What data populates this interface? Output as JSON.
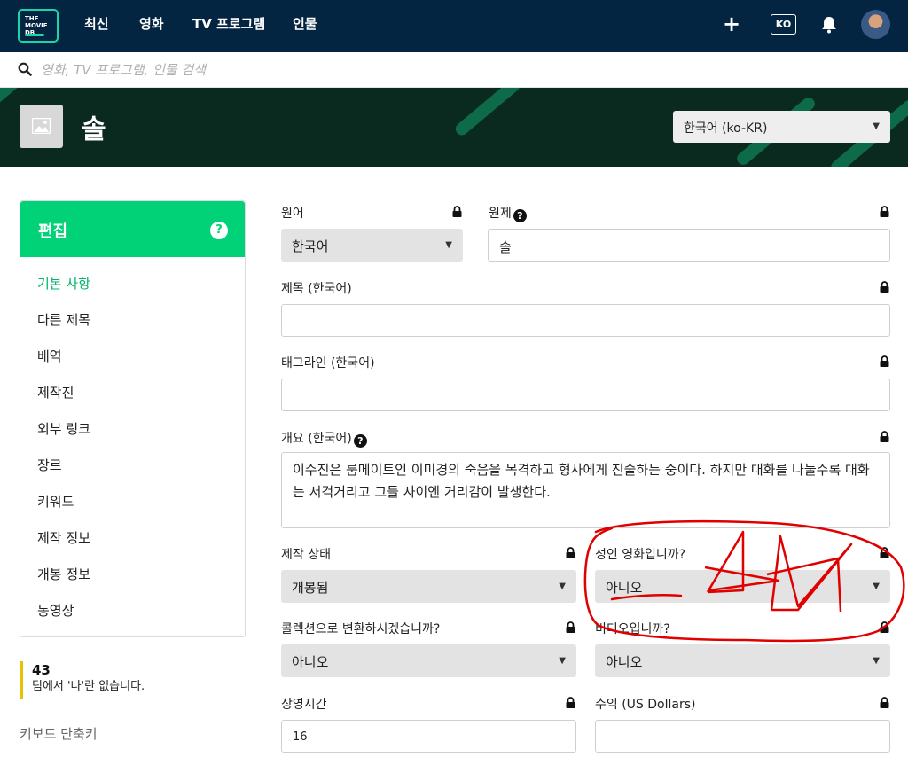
{
  "nav": {
    "logo_text": "THE\nMOVIE\nDB",
    "links": [
      "최신",
      "영화",
      "TV 프로그램",
      "인물"
    ],
    "add_label": "+",
    "language_code": "KO"
  },
  "search": {
    "placeholder": "영화, TV 프로그램, 인물 검색"
  },
  "hero": {
    "title": "솔",
    "language_select": "한국어 (ko-KR)"
  },
  "sidebar": {
    "title": "편집",
    "help": "?",
    "items": [
      "기본 사항",
      "다른 제목",
      "배역",
      "제작진",
      "외부 링크",
      "장르",
      "키워드",
      "제작 정보",
      "개봉 정보",
      "동영상"
    ],
    "active_index": 0
  },
  "team": {
    "count": "43",
    "text": "팀에서 '나'란 없습니다."
  },
  "keyboard_shortcuts": "키보드 단축키",
  "form": {
    "original_language": {
      "label": "원어",
      "value": "한국어"
    },
    "original_title": {
      "label": "원제",
      "value": "솔"
    },
    "title_ko": {
      "label": "제목 (한국어)",
      "value": ""
    },
    "tagline_ko": {
      "label": "태그라인 (한국어)",
      "value": ""
    },
    "overview_ko": {
      "label": "개요 (한국어)",
      "value": "이수진은 룸메이트인 이미경의 죽음을 목격하고 형사에게 진술하는 중이다. 하지만 대화를 나눌수록 대화는 서걱거리고 그들 사이엔 거리감이 발생한다."
    },
    "status": {
      "label": "제작 상태",
      "value": "개봉됨"
    },
    "adult": {
      "label": "성인 영화입니까?",
      "value": "아니오"
    },
    "collection": {
      "label": "콜렉션으로 변환하시겠습니까?",
      "value": "아니오"
    },
    "video": {
      "label": "비디오입니까?",
      "value": "아니오"
    },
    "runtime": {
      "label": "상영시간",
      "value": "16"
    },
    "revenue": {
      "label": "수익 (US Dollars)",
      "value": ""
    }
  },
  "colors": {
    "nav_bg": "#032541",
    "accent_green": "#01d277",
    "annotation_red": "#e00000"
  }
}
